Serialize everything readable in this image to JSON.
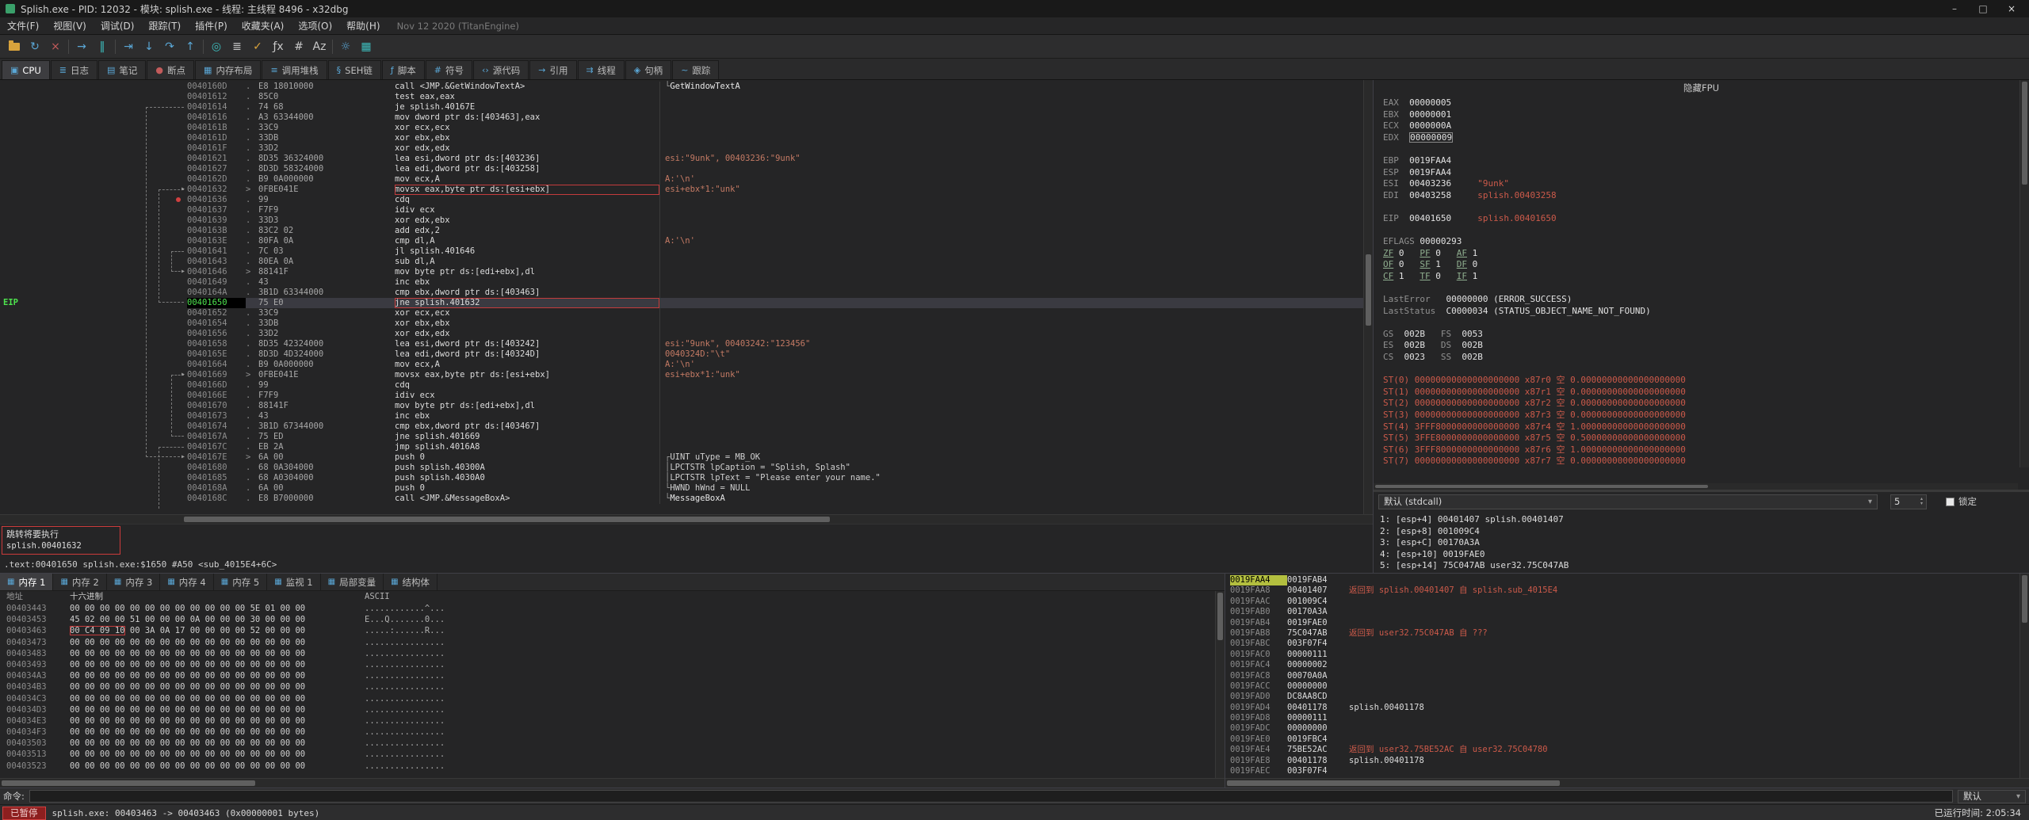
{
  "window": {
    "title": "Splish.exe - PID: 12032 - 模块: splish.exe - 线程: 主线程 8496 - x32dbg",
    "minimize": "–",
    "maximize": "□",
    "close": "×"
  },
  "menu": {
    "items": [
      "文件(F)",
      "视图(V)",
      "调试(D)",
      "跟踪(T)",
      "插件(P)",
      "收藏夹(A)",
      "选项(O)",
      "帮助(H)"
    ],
    "version": "Nov 12 2020 (TitanEngine)"
  },
  "ui_icons": {
    "caret": "▾",
    "spin_up": "▴",
    "spin_down": "▾",
    "arrow_head": "▸",
    "dump_tab_icon": "▦"
  },
  "toolbar": {
    "icons": [
      {
        "name": "open-file-icon",
        "folder": true
      },
      {
        "name": "restart-icon",
        "glyph": "↻",
        "color": "#5aa7d6"
      },
      {
        "name": "close-icon",
        "glyph": "×",
        "color": "#c35b5b"
      },
      {
        "sep": true
      },
      {
        "name": "run-icon",
        "glyph": "→",
        "color": "#5aa7d6"
      },
      {
        "name": "pause-icon",
        "glyph": "‖",
        "color": "#3dbdbd"
      },
      {
        "sep": true
      },
      {
        "name": "run-to-user-code-icon",
        "glyph": "⇥",
        "color": "#5aa7d6"
      },
      {
        "name": "step-into-icon",
        "glyph": "↓",
        "color": "#5aa7d6"
      },
      {
        "name": "step-over-icon",
        "glyph": "↷",
        "color": "#5aa7d6"
      },
      {
        "name": "execute-till-return-icon",
        "glyph": "↑",
        "color": "#5aa7d6"
      },
      {
        "sep": true
      },
      {
        "name": "advanced-icon",
        "glyph": "◎",
        "color": "#3dbdbd"
      },
      {
        "name": "log-icon",
        "glyph": "≣",
        "color": "#c8c8c8"
      },
      {
        "name": "patch-icon",
        "glyph": "✓",
        "color": "#d9a33c"
      },
      {
        "name": "fx-icon",
        "glyph": "ƒx",
        "color": "#c8c8c8"
      },
      {
        "name": "hash-icon",
        "glyph": "#",
        "color": "#c8c8c8"
      },
      {
        "name": "strings-icon",
        "glyph": "Az",
        "color": "#c8c8c8"
      },
      {
        "sep": true
      },
      {
        "name": "settings-icon",
        "glyph": "☼",
        "color": "#5aa7d6"
      },
      {
        "name": "cpu-icon",
        "glyph": "▦",
        "color": "#3dbdbd"
      }
    ]
  },
  "tabs": [
    {
      "name": "tab-cpu",
      "label": "CPU",
      "icon": "▣",
      "active": true
    },
    {
      "name": "tab-log",
      "label": "日志",
      "icon": "≣"
    },
    {
      "name": "tab-notes",
      "label": "笔记",
      "icon": "▤"
    },
    {
      "name": "tab-breakpoints",
      "label": "断点",
      "icon": "●",
      "icon_color": "#c35b5b"
    },
    {
      "name": "tab-memory-map",
      "label": "内存布局",
      "icon": "▦"
    },
    {
      "name": "tab-call-stack",
      "label": "调用堆栈",
      "icon": "≡"
    },
    {
      "name": "tab-seh",
      "label": "SEH链",
      "icon": "§"
    },
    {
      "name": "tab-script",
      "label": "脚本",
      "icon": "ƒ"
    },
    {
      "name": "tab-symbols",
      "label": "符号",
      "icon": "#"
    },
    {
      "name": "tab-source",
      "label": "源代码",
      "icon": "‹›"
    },
    {
      "name": "tab-references",
      "label": "引用",
      "icon": "→"
    },
    {
      "name": "tab-threads",
      "label": "线程",
      "icon": "⇉"
    },
    {
      "name": "tab-handles",
      "label": "句柄",
      "icon": "◈"
    },
    {
      "name": "tab-trace",
      "label": "跟踪",
      "icon": "~"
    }
  ],
  "disasm": {
    "eip_label": "EIP",
    "rows": [
      {
        "a": "0040160D",
        "m": ".",
        "b": "E8 18010000",
        "i": "call <JMP.&GetWindowTextA>",
        "br": "└",
        "c": "GetWindowTextA",
        "cc": "api"
      },
      {
        "a": "00401612",
        "m": ".",
        "b": "85C0",
        "i": "test eax,eax"
      },
      {
        "a": "00401614",
        "m": ".",
        "b": "74 68",
        "i": "je splish.40167E"
      },
      {
        "a": "00401616",
        "m": ".",
        "b": "A3 63344000",
        "i": "mov dword ptr ds:[403463],eax"
      },
      {
        "a": "0040161B",
        "m": ".",
        "b": "33C9",
        "i": "xor ecx,ecx"
      },
      {
        "a": "0040161D",
        "m": ".",
        "b": "33DB",
        "i": "xor ebx,ebx"
      },
      {
        "a": "0040161F",
        "m": ".",
        "b": "33D2",
        "i": "xor edx,edx"
      },
      {
        "a": "00401621",
        "m": ".",
        "b": "8D35 36324000",
        "i": "lea esi,dword ptr ds:[403236]",
        "c": "esi:\"9unk\", 00403236:\"9unk\"",
        "cc": "str"
      },
      {
        "a": "00401627",
        "m": ".",
        "b": "8D3D 58324000",
        "i": "lea edi,dword ptr ds:[403258]"
      },
      {
        "a": "0040162D",
        "m": ".",
        "b": "B9 0A000000",
        "i": "mov ecx,A",
        "c": "A:'\\n'",
        "cc": "str"
      },
      {
        "a": "00401632",
        "m": ">",
        "b": "0FBE041E",
        "i": "movsx eax,byte ptr ds:[esi+ebx]",
        "c": "esi+ebx*1:\"unk\"",
        "cc": "str",
        "box": true
      },
      {
        "a": "00401636",
        "m": ".",
        "b": "99",
        "i": "cdq",
        "dot": true
      },
      {
        "a": "00401637",
        "m": ".",
        "b": "F7F9",
        "i": "idiv ecx"
      },
      {
        "a": "00401639",
        "m": ".",
        "b": "33D3",
        "i": "xor edx,ebx"
      },
      {
        "a": "0040163B",
        "m": ".",
        "b": "83C2 02",
        "i": "add edx,2"
      },
      {
        "a": "0040163E",
        "m": ".",
        "b": "80FA 0A",
        "i": "cmp dl,A",
        "c": "A:'\\n'",
        "cc": "str"
      },
      {
        "a": "00401641",
        "m": ".",
        "b": "7C 03",
        "i": "jl splish.401646"
      },
      {
        "a": "00401643",
        "m": ".",
        "b": "80EA 0A",
        "i": "sub dl,A"
      },
      {
        "a": "00401646",
        "m": ">",
        "b": "88141F",
        "i": "mov byte ptr ds:[edi+ebx],dl"
      },
      {
        "a": "00401649",
        "m": ".",
        "b": "43",
        "i": "inc ebx"
      },
      {
        "a": "0040164A",
        "m": ".",
        "b": "3B1D 63344000",
        "i": "cmp ebx,dword ptr ds:[403463]"
      },
      {
        "a": "00401650",
        "m": "",
        "b": "75 E0",
        "i": "jne splish.401632",
        "sel": true,
        "box": true
      },
      {
        "a": "00401652",
        "m": ".",
        "b": "33C9",
        "i": "xor ecx,ecx"
      },
      {
        "a": "00401654",
        "m": ".",
        "b": "33DB",
        "i": "xor ebx,ebx"
      },
      {
        "a": "00401656",
        "m": ".",
        "b": "33D2",
        "i": "xor edx,edx"
      },
      {
        "a": "00401658",
        "m": ".",
        "b": "8D35 42324000",
        "i": "lea esi,dword ptr ds:[403242]",
        "c": "esi:\"9unk\", 00403242:\"123456\"",
        "cc": "str"
      },
      {
        "a": "0040165E",
        "m": ".",
        "b": "8D3D 4D324000",
        "i": "lea edi,dword ptr ds:[40324D]",
        "c": "0040324D:\"\\t\"",
        "cc": "str"
      },
      {
        "a": "00401664",
        "m": ".",
        "b": "B9 0A000000",
        "i": "mov ecx,A",
        "c": "A:'\\n'",
        "cc": "str"
      },
      {
        "a": "00401669",
        "m": ">",
        "b": "0FBE041E",
        "i": "movsx eax,byte ptr ds:[esi+ebx]",
        "c": "esi+ebx*1:\"unk\"",
        "cc": "str"
      },
      {
        "a": "0040166D",
        "m": ".",
        "b": "99",
        "i": "cdq"
      },
      {
        "a": "0040166E",
        "m": ".",
        "b": "F7F9",
        "i": "idiv ecx"
      },
      {
        "a": "00401670",
        "m": ".",
        "b": "88141F",
        "i": "mov byte ptr ds:[edi+ebx],dl"
      },
      {
        "a": "00401673",
        "m": ".",
        "b": "43",
        "i": "inc ebx"
      },
      {
        "a": "00401674",
        "m": ".",
        "b": "3B1D 67344000",
        "i": "cmp ebx,dword ptr ds:[403467]"
      },
      {
        "a": "0040167A",
        "m": ".",
        "b": "75 ED",
        "i": "jne splish.401669"
      },
      {
        "a": "0040167C",
        "m": ".",
        "b": "EB 2A",
        "i": "jmp splish.4016A8"
      },
      {
        "a": "0040167E",
        "m": ">",
        "b": "6A 00",
        "i": "push 0",
        "br": "┌",
        "c": "UINT uType = MB_OK",
        "cc": "plain"
      },
      {
        "a": "00401680",
        "m": ".",
        "b": "68 0A304000",
        "i": "push splish.40300A",
        "br": "│",
        "c": "LPCTSTR lpCaption = \"Splish, Splash\"",
        "cc": "plain"
      },
      {
        "a": "00401685",
        "m": ".",
        "b": "68 A0304000",
        "i": "push splish.4030A0",
        "br": "│",
        "c": "LPCTSTR lpText = \"Please enter your name.\"",
        "cc": "plain"
      },
      {
        "a": "0040168A",
        "m": ".",
        "b": "6A 00",
        "i": "push 0",
        "br": "└",
        "c": "HWND hWnd = NULL",
        "cc": "plain"
      },
      {
        "a": "0040168C",
        "m": ".",
        "b": "E8 B7000000",
        "i": "call <JMP.&MessageBoxA>",
        "br": "└",
        "c": "MessageBoxA",
        "cc": "api"
      }
    ],
    "arcs": [
      {
        "f": 2,
        "t": 36,
        "d": 3
      },
      {
        "f": 16,
        "t": 18,
        "d": 1
      },
      {
        "f": 21,
        "t": 10,
        "d": 2
      },
      {
        "f": 34,
        "t": 28,
        "d": 1
      },
      {
        "f": 35,
        "t": 41,
        "d": 2,
        "open": true
      }
    ],
    "jump_note": {
      "line1": "跳转将要执行",
      "line2": "splish.00401632"
    },
    "info_line": ".text:00401650 splish.exe:$1650 #A50 <sub_4015E4+6C>"
  },
  "registers": {
    "fpu_toggle": "隐藏FPU",
    "lines": [
      [
        [
          "lbl",
          "EAX  "
        ],
        [
          "val",
          "00000005"
        ]
      ],
      [
        [
          "lbl",
          "EBX  "
        ],
        [
          "val",
          "00000001"
        ]
      ],
      [
        [
          "lbl",
          "ECX  "
        ],
        [
          "val",
          "0000000A"
        ]
      ],
      [
        [
          "lbl",
          "EDX  "
        ],
        [
          "sel",
          "00000009"
        ]
      ],
      [],
      [
        [
          "lbl",
          "EBP  "
        ],
        [
          "val",
          "0019FAA4"
        ]
      ],
      [
        [
          "lbl",
          "ESP  "
        ],
        [
          "val",
          "0019FAA4"
        ]
      ],
      [
        [
          "lbl",
          "ESI  "
        ],
        [
          "val",
          "00403236"
        ],
        [
          "pad",
          "     "
        ],
        [
          "red",
          "\"9unk\""
        ]
      ],
      [
        [
          "lbl",
          "EDI  "
        ],
        [
          "val",
          "00403258"
        ],
        [
          "pad",
          "     "
        ],
        [
          "red",
          "splish.00403258"
        ]
      ],
      [],
      [
        [
          "lbl",
          "EIP  "
        ],
        [
          "val",
          "00401650"
        ],
        [
          "pad",
          "     "
        ],
        [
          "red",
          "splish.00401650"
        ]
      ],
      [],
      [
        [
          "lbl",
          "EFLAGS "
        ],
        [
          "val",
          "00000293"
        ]
      ],
      [
        [
          "flag",
          "ZF"
        ],
        [
          "val",
          " 0   "
        ],
        [
          "flag",
          "PF"
        ],
        [
          "val",
          " 0   "
        ],
        [
          "flag",
          "AF"
        ],
        [
          "val",
          " 1"
        ]
      ],
      [
        [
          "flag",
          "OF"
        ],
        [
          "val",
          " 0   "
        ],
        [
          "flag",
          "SF"
        ],
        [
          "val",
          " 1   "
        ],
        [
          "flag",
          "DF"
        ],
        [
          "val",
          " 0"
        ]
      ],
      [
        [
          "flag",
          "CF"
        ],
        [
          "val",
          " 1   "
        ],
        [
          "flag",
          "TF"
        ],
        [
          "val",
          " 0   "
        ],
        [
          "flag",
          "IF"
        ],
        [
          "val",
          " 1"
        ]
      ],
      [],
      [
        [
          "lbl",
          "LastError   "
        ],
        [
          "val",
          "00000000 (ERROR_SUCCESS)"
        ]
      ],
      [
        [
          "lbl",
          "LastStatus  "
        ],
        [
          "val",
          "C0000034 (STATUS_OBJECT_NAME_NOT_FOUND)"
        ]
      ],
      [],
      [
        [
          "lbl",
          "GS  "
        ],
        [
          "val",
          "002B"
        ],
        [
          "pad",
          "   "
        ],
        [
          "lbl",
          "FS  "
        ],
        [
          "val",
          "0053"
        ]
      ],
      [
        [
          "lbl",
          "ES  "
        ],
        [
          "val",
          "002B"
        ],
        [
          "pad",
          "   "
        ],
        [
          "lbl",
          "DS  "
        ],
        [
          "val",
          "002B"
        ]
      ],
      [
        [
          "lbl",
          "CS  "
        ],
        [
          "val",
          "0023"
        ],
        [
          "pad",
          "   "
        ],
        [
          "lbl",
          "SS  "
        ],
        [
          "val",
          "002B"
        ]
      ],
      [],
      [
        [
          "red",
          "ST(0) 00000000000000000000 x87r0 空 0.00000000000000000000"
        ]
      ],
      [
        [
          "red",
          "ST(1) 00000000000000000000 x87r1 空 0.00000000000000000000"
        ]
      ],
      [
        [
          "red",
          "ST(2) 00000000000000000000 x87r2 空 0.00000000000000000000"
        ]
      ],
      [
        [
          "red",
          "ST(3) 00000000000000000000 x87r3 空 0.00000000000000000000"
        ]
      ],
      [
        [
          "red",
          "ST(4) 3FFF8000000000000000 x87r4 空 1.00000000000000000000"
        ]
      ],
      [
        [
          "red",
          "ST(5) 3FFE8000000000000000 x87r5 空 0.50000000000000000000"
        ]
      ],
      [
        [
          "red",
          "ST(6) 3FFF8000000000000000 x87r6 空 1.00000000000000000000"
        ]
      ],
      [
        [
          "red",
          "ST(7) 00000000000000000000 x87r7 空 0.00000000000000000000"
        ]
      ]
    ],
    "callconv": {
      "name": "默认 (stdcall)",
      "depth": "5",
      "lock_label": "锁定"
    },
    "args": [
      "1: [esp+4] 00401407 splish.00401407",
      "2: [esp+8] 001009C4",
      "3: [esp+C] 00170A3A",
      "4: [esp+10] 0019FAE0",
      "5: [esp+14] 75C047AB user32.75C047AB"
    ]
  },
  "dump": {
    "tabs": [
      {
        "name": "tab-memory-1",
        "label": "内存 1",
        "active": true
      },
      {
        "name": "tab-memory-2",
        "label": "内存 2"
      },
      {
        "name": "tab-memory-3",
        "label": "内存 3"
      },
      {
        "name": "tab-memory-4",
        "label": "内存 4"
      },
      {
        "name": "tab-memory-5",
        "label": "内存 5"
      },
      {
        "name": "tab-watch-1",
        "label": "监视 1"
      },
      {
        "name": "tab-locals",
        "label": "局部变量"
      },
      {
        "name": "tab-struct",
        "label": "结构体"
      }
    ],
    "headers": [
      "地址",
      "十六进制",
      "ASCII"
    ],
    "rows": [
      {
        "a": "00403443",
        "pre": "00 00 00 00 00 00 00 00 00 00 00 00 5E 01 00 00",
        "ascii": "............^..."
      },
      {
        "a": "00403453",
        "pre": "45 02 00 00 51 00 00 00 0A 00 00 00 30 00 00 00",
        "ascii": "E...Q.......0..."
      },
      {
        "a": "00403463",
        "box": "00 C4 09 10",
        "post": " 00 3A 0A 17 00 00 00 00 52 00 00 00",
        "ascii": ".....:......R..."
      },
      {
        "a": "00403473",
        "pre": "00 00 00 00 00 00 00 00 00 00 00 00 00 00 00 00",
        "ascii": "................"
      },
      {
        "a": "00403483",
        "pre": "00 00 00 00 00 00 00 00 00 00 00 00 00 00 00 00",
        "ascii": "................"
      },
      {
        "a": "00403493",
        "pre": "00 00 00 00 00 00 00 00 00 00 00 00 00 00 00 00",
        "ascii": "................"
      },
      {
        "a": "004034A3",
        "pre": "00 00 00 00 00 00 00 00 00 00 00 00 00 00 00 00",
        "ascii": "................"
      },
      {
        "a": "004034B3",
        "pre": "00 00 00 00 00 00 00 00 00 00 00 00 00 00 00 00",
        "ascii": "................"
      },
      {
        "a": "004034C3",
        "pre": "00 00 00 00 00 00 00 00 00 00 00 00 00 00 00 00",
        "ascii": "................"
      },
      {
        "a": "004034D3",
        "pre": "00 00 00 00 00 00 00 00 00 00 00 00 00 00 00 00",
        "ascii": "................"
      },
      {
        "a": "004034E3",
        "pre": "00 00 00 00 00 00 00 00 00 00 00 00 00 00 00 00",
        "ascii": "................"
      },
      {
        "a": "004034F3",
        "pre": "00 00 00 00 00 00 00 00 00 00 00 00 00 00 00 00",
        "ascii": "................"
      },
      {
        "a": "00403503",
        "pre": "00 00 00 00 00 00 00 00 00 00 00 00 00 00 00 00",
        "ascii": "................"
      },
      {
        "a": "00403513",
        "pre": "00 00 00 00 00 00 00 00 00 00 00 00 00 00 00 00",
        "ascii": "................"
      },
      {
        "a": "00403523",
        "pre": "00 00 00 00 00 00 00 00 00 00 00 00 00 00 00 00",
        "ascii": "................"
      }
    ]
  },
  "stack": {
    "rows": [
      {
        "a": "0019FAA4",
        "v": "0019FAB4",
        "hl": true
      },
      {
        "a": "0019FAA8",
        "v": "00401407",
        "n": "返回到 splish.00401407 自 splish.sub_4015E4",
        "nc": "ret"
      },
      {
        "a": "0019FAAC",
        "v": "001009C4"
      },
      {
        "a": "0019FAB0",
        "v": "00170A3A"
      },
      {
        "a": "0019FAB4",
        "v": "0019FAE0"
      },
      {
        "a": "0019FAB8",
        "v": "75C047AB",
        "n": "返回到 user32.75C047AB 自 ???",
        "nc": "ret"
      },
      {
        "a": "0019FABC",
        "v": "003F07F4"
      },
      {
        "a": "0019FAC0",
        "v": "00000111"
      },
      {
        "a": "0019FAC4",
        "v": "00000002"
      },
      {
        "a": "0019FAC8",
        "v": "00070A0A"
      },
      {
        "a": "0019FACC",
        "v": "00000000"
      },
      {
        "a": "0019FAD0",
        "v": "DC8AA8CD"
      },
      {
        "a": "0019FAD4",
        "v": "00401178",
        "n": "splish.00401178",
        "nc": "sym"
      },
      {
        "a": "0019FAD8",
        "v": "00000111"
      },
      {
        "a": "0019FADC",
        "v": "00000000"
      },
      {
        "a": "0019FAE0",
        "v": "0019FBC4"
      },
      {
        "a": "0019FAE4",
        "v": "75BE52AC",
        "n": "返回到 user32.75BE52AC 自 user32.75C04780",
        "nc": "ret"
      },
      {
        "a": "0019FAE8",
        "v": "00401178",
        "n": "splish.00401178",
        "nc": "sym"
      },
      {
        "a": "0019FAEC",
        "v": "003F07F4"
      }
    ]
  },
  "command": {
    "label": "命令:",
    "default": "默认"
  },
  "status": {
    "state": "已暂停",
    "message": "splish.exe: 00403463 -> 00403463 (0x00000001 bytes)",
    "time": "已运行时间: 2:05:34"
  }
}
